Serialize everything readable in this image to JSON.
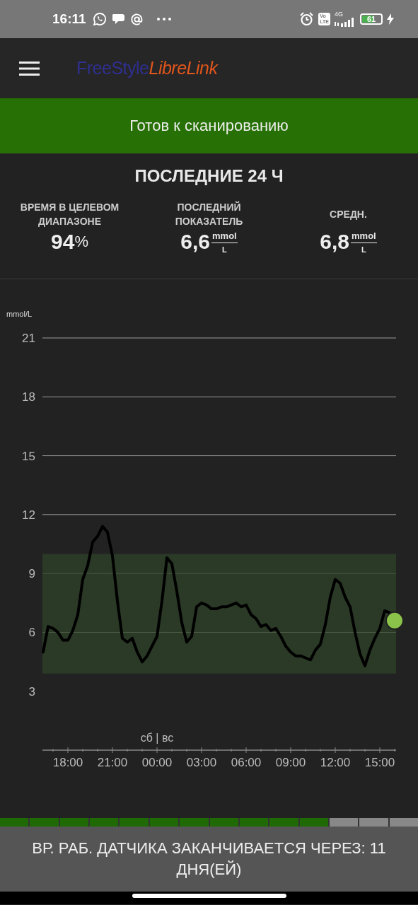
{
  "status_bar": {
    "time": "16:11",
    "volte_top": "Vo",
    "volte_bottom": "LTE",
    "network": "4G",
    "battery": "61"
  },
  "header": {
    "logo_part_1": "FreeStyle",
    "logo_part_2": "LibreLink"
  },
  "banner": {
    "text": "Готов к сканированию"
  },
  "summary": {
    "title": "ПОСЛЕДНИЕ 24 Ч",
    "stats": [
      {
        "kind": "percent",
        "label": "ВРЕМЯ В ЦЕЛЕВОМ ДИАПАЗОНЕ",
        "value": "94",
        "unit": "%"
      },
      {
        "kind": "fraction",
        "label": "ПОСЛЕДНИЙ ПОКАЗАТЕЛЬ",
        "value": "6,6",
        "unit_top": "mmol",
        "unit_bottom": "L"
      },
      {
        "kind": "fraction",
        "label": "СРЕДН.",
        "value": "6,8",
        "unit_top": "mmol",
        "unit_bottom": "L"
      }
    ]
  },
  "graph": {
    "chart_data": {
      "type": "line",
      "ylabel": "mmol/L",
      "grid": true,
      "ylim": [
        0,
        21
      ],
      "yticks": [
        3,
        6,
        9,
        12,
        15,
        18,
        21
      ],
      "categories": [
        null,
        null,
        null,
        null,
        null,
        "18:00",
        null,
        null,
        null,
        null,
        null,
        null,
        null,
        null,
        "21:00",
        null,
        null,
        null,
        null,
        null,
        null,
        null,
        null,
        "00:00",
        null,
        null,
        null,
        null,
        null,
        null,
        null,
        null,
        "03:00",
        null,
        null,
        null,
        null,
        null,
        null,
        null,
        null,
        "06:00",
        null,
        null,
        null,
        null,
        null,
        null,
        null,
        null,
        "09:00",
        null,
        null,
        null,
        null,
        null,
        null,
        null,
        null,
        "12:00",
        null,
        null,
        null,
        null,
        null,
        null,
        null,
        null,
        "15:00",
        null,
        null,
        null
      ],
      "series": [
        {
          "color": "#000000",
          "values": [
            5.0,
            6.3,
            6.2,
            6.0,
            5.6,
            5.6,
            6.1,
            6.9,
            8.7,
            9.4,
            10.6,
            10.9,
            11.4,
            11.1,
            9.9,
            7.6,
            5.7,
            5.5,
            5.7,
            5.0,
            4.5,
            4.8,
            5.3,
            5.8,
            7.6,
            9.8,
            9.5,
            8.1,
            6.5,
            5.5,
            5.8,
            7.3,
            7.5,
            7.4,
            7.2,
            7.2,
            7.3,
            7.3,
            7.4,
            7.5,
            7.3,
            7.4,
            6.9,
            6.7,
            6.3,
            6.4,
            6.1,
            6.2,
            5.8,
            5.3,
            5.0,
            4.8,
            4.8,
            4.7,
            4.6,
            5.1,
            5.4,
            6.4,
            7.8,
            8.7,
            8.5,
            7.8,
            7.3,
            6.0,
            4.9,
            4.3,
            5.1,
            5.7,
            6.2,
            7.1,
            7.0,
            6.6
          ]
        }
      ],
      "bands": [
        {
          "axis": "y",
          "from": 3.9,
          "to": 10
        }
      ],
      "annotations": [
        "сб | вс"
      ]
    }
  },
  "sensor": {
    "segments": [
      {
        "elapsed": true
      },
      {
        "elapsed": true
      },
      {
        "elapsed": true
      },
      {
        "elapsed": true
      },
      {
        "elapsed": true
      },
      {
        "elapsed": true
      },
      {
        "elapsed": true
      },
      {
        "elapsed": true
      },
      {
        "elapsed": true
      },
      {
        "elapsed": true
      },
      {
        "elapsed": true
      },
      {
        "elapsed": false
      },
      {
        "elapsed": false
      },
      {
        "elapsed": false
      }
    ],
    "message": "ВР. РАБ. ДАТЧИКА ЗАКАНЧИВАЕТСЯ ЧЕРЕЗ: 11 ДНЯ(ЕЙ)"
  }
}
